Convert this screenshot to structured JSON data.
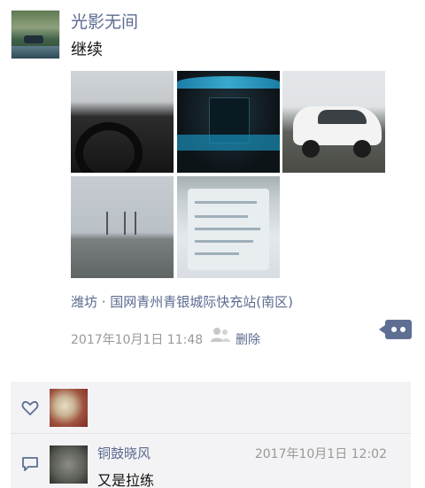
{
  "post": {
    "username": "光影无间",
    "text": "继续",
    "location": "潍坊 · 国网青州青银城际快充站(南区)",
    "time": "2017年10月1日 11:48",
    "delete_label": "删除",
    "photo_count": 5
  },
  "icons": {
    "privacy": "people-icon",
    "more": "more-dots-icon",
    "like": "heart-icon",
    "comment": "comment-icon"
  },
  "comment": {
    "name": "铜鼓晓风",
    "time": "2017年10月1日 12:02",
    "text": "又是拉练"
  },
  "colors": {
    "link": "#5b6a8f",
    "meta_gray": "#999999",
    "interaction_bg": "#f3f3f5"
  }
}
